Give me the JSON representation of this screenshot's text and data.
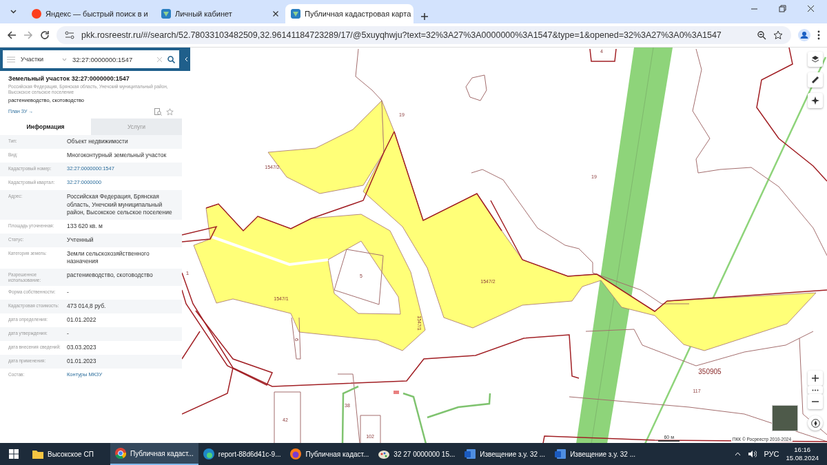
{
  "browser": {
    "tabs": [
      {
        "title": "Яндекс — быстрый поиск в и",
        "selected": false
      },
      {
        "title": "Личный кабинет",
        "selected": false
      },
      {
        "title": "Публичная кадастровая карта",
        "selected": true
      }
    ],
    "url": "pkk.rosreestr.ru/#/search/52.78033103482509,32.96141184723289/17/@5xuyqhwju?text=32%3A27%3A0000000%3A1547&type=1&opened=32%3A27%3A0%3A1547"
  },
  "search": {
    "layer": "Участки",
    "value": "32:27:0000000:1547"
  },
  "parcel": {
    "title": "Земельный участок 32:27:0000000:1547",
    "address": "Российская Федерация, Брянская область, Унечский муниципальный район, Высокское сельское поселение",
    "use": "растениеводство, скотоводство",
    "plan_link": "План ЗУ →"
  },
  "info_tabs": [
    {
      "label": "Информация",
      "selected": true
    },
    {
      "label": "Услуги",
      "selected": false
    }
  ],
  "attributes": [
    {
      "label": "Тип:",
      "value": "Объект недвижимости",
      "kind": "text"
    },
    {
      "label": "Вид:",
      "value": "Многоконтурный земельный участок",
      "kind": "text"
    },
    {
      "label": "Кадастровый номер:",
      "value": "32:27:0000000:1547",
      "kind": "link"
    },
    {
      "label": "Кадастровый квартал:",
      "value": "32:27:0000000",
      "kind": "link"
    },
    {
      "label": "Адрес:",
      "value": "Российская Федерация, Брянская область, Унечский муниципальный район, Высокское сельское поселение",
      "kind": "text"
    },
    {
      "label": "Площадь уточненная:",
      "value": "133 620 кв. м",
      "kind": "text"
    },
    {
      "label": "Статус:",
      "value": "Учтенный",
      "kind": "text"
    },
    {
      "label": "Категория земель:",
      "value": "Земли сельскохозяйственного назначения",
      "kind": "text"
    },
    {
      "label": "Разрешенное использование:",
      "value": "растениеводство, скотоводство",
      "kind": "text"
    },
    {
      "label": "Форма собственности:",
      "value": "-",
      "kind": "text"
    },
    {
      "label": "Кадастровая стоимость:",
      "value": "473 014,8 руб.",
      "kind": "text"
    },
    {
      "label": "дата определения:",
      "value": "01.01.2022",
      "kind": "text"
    },
    {
      "label": "дата утверждения:",
      "value": "-",
      "kind": "text"
    },
    {
      "label": "дата внесения сведений:",
      "value": "03.03.2023",
      "kind": "text"
    },
    {
      "label": "дата применения:",
      "value": "01.01.2023",
      "kind": "text"
    },
    {
      "label": "Состав:",
      "value": "Контуры МКЗУ",
      "kind": "link"
    }
  ],
  "map": {
    "labels": [
      {
        "text": "4"
      },
      {
        "text": "19"
      },
      {
        "text": "1547/2"
      },
      {
        "text": "19"
      },
      {
        "text": "1"
      },
      {
        "text": "5"
      },
      {
        "text": "1547/2"
      },
      {
        "text": "1547/1"
      },
      {
        "text": "1547/1"
      },
      {
        "text": "6"
      },
      {
        "text": "350905"
      },
      {
        "text": "117"
      },
      {
        "text": "38"
      },
      {
        "text": "42"
      },
      {
        "text": "102"
      }
    ],
    "scale": "60 м",
    "copyright": "ПКК © Росреестр 2010-2024"
  },
  "taskbar": {
    "items": [
      {
        "label": "Высокское СП",
        "selected": false
      },
      {
        "label": "Публичная кадаст...",
        "selected": true
      },
      {
        "label": "report-88d6d41c-9...",
        "selected": false
      },
      {
        "label": "Публичная кадаст...",
        "selected": false
      },
      {
        "label": "32  27  0000000  15...",
        "selected": false
      },
      {
        "label": "Извещение з.у. 32 ...",
        "selected": false
      },
      {
        "label": "Извещение з.у. 32 ...",
        "selected": false
      }
    ],
    "lang": "РУС",
    "time": "16:16",
    "date": "15.08.2024"
  }
}
